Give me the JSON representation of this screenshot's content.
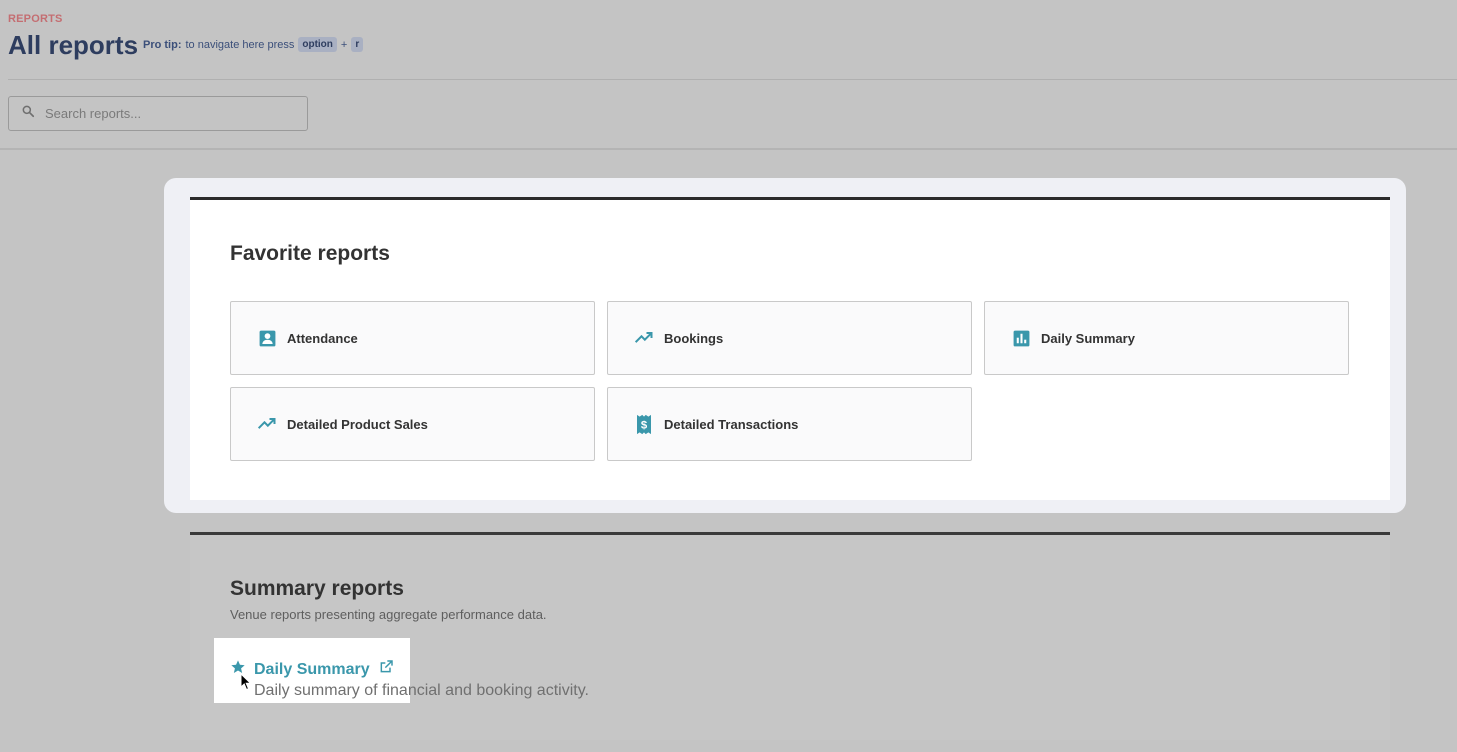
{
  "header": {
    "eyebrow": "REPORTS",
    "title": "All reports",
    "tip_label": "Pro tip:",
    "tip_text": "to navigate here press",
    "key1": "option",
    "plus": "+",
    "key2": "r"
  },
  "search": {
    "placeholder": "Search reports...",
    "value": "",
    "icon": "search-icon"
  },
  "favorites": {
    "title": "Favorite reports",
    "items": [
      {
        "label": "Attendance",
        "icon": "person-badge-icon"
      },
      {
        "label": "Bookings",
        "icon": "trending-up-icon"
      },
      {
        "label": "Daily Summary",
        "icon": "bar-chart-icon"
      },
      {
        "label": "Detailed Product Sales",
        "icon": "trending-up-icon"
      },
      {
        "label": "Detailed Transactions",
        "icon": "receipt-dollar-icon"
      }
    ]
  },
  "summary": {
    "title": "Summary reports",
    "subtitle": "Venue reports presenting aggregate performance data.",
    "items": [
      {
        "label": "Daily Summary",
        "description": "Daily summary of financial and booking activity.",
        "favorite_icon": "star-icon",
        "link_icon": "external-link-icon"
      }
    ]
  },
  "colors": {
    "accent": "#3a97ab",
    "title": "#2e3d5f",
    "eyebrow": "#c46e72"
  }
}
